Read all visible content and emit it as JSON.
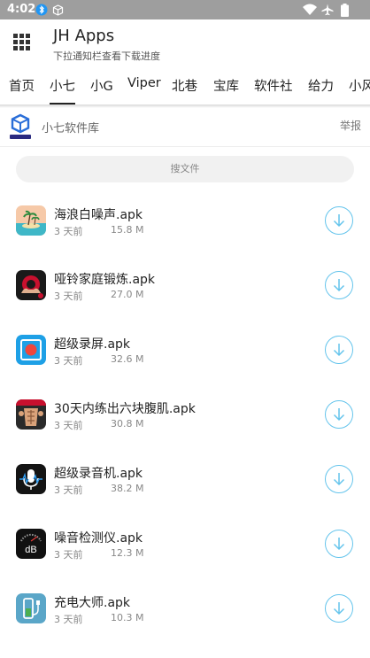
{
  "status_bar": {
    "time": "4:02",
    "left_icons": [
      "bluetooth-icon",
      "cube-icon"
    ],
    "right_icons": [
      "wifi-icon",
      "airplane-icon",
      "battery-icon"
    ]
  },
  "app_bar": {
    "title": "JH Apps",
    "subtitle": "下拉通知栏查看下载进度",
    "menu_icon": "grid-icon"
  },
  "tabs": [
    {
      "label": "首页",
      "active": false
    },
    {
      "label": "小七",
      "active": true
    },
    {
      "label": "小G",
      "active": false
    },
    {
      "label": "Viper",
      "active": false
    },
    {
      "label": "北巷",
      "active": false
    },
    {
      "label": "宝库",
      "active": false
    },
    {
      "label": "软件社",
      "active": false
    },
    {
      "label": "给力",
      "active": false
    },
    {
      "label": "小风",
      "active": false
    }
  ],
  "source": {
    "name": "小七软件库",
    "report_label": "举报"
  },
  "search": {
    "placeholder": "搜文件"
  },
  "files": [
    {
      "name": "海浪白噪声.apk",
      "ago": "3 天前",
      "size": "15.8 M",
      "icon": "beach-icon"
    },
    {
      "name": "哑铃家庭锻炼.apk",
      "ago": "3 天前",
      "size": "27.0 M",
      "icon": "fitness-icon"
    },
    {
      "name": "超级录屏.apk",
      "ago": "3 天前",
      "size": "32.6 M",
      "icon": "record-icon"
    },
    {
      "name": "30天内练出六块腹肌.apk",
      "ago": "3 天前",
      "size": "30.8 M",
      "icon": "abs-icon"
    },
    {
      "name": "超级录音机.apk",
      "ago": "3 天前",
      "size": "38.2 M",
      "icon": "microphone-icon"
    },
    {
      "name": "噪音检测仪.apk",
      "ago": "3 天前",
      "size": "12.3 M",
      "icon": "db-meter-icon"
    },
    {
      "name": "充电大师.apk",
      "ago": "3 天前",
      "size": "10.3 M",
      "icon": "charging-icon"
    }
  ],
  "colors": {
    "accent": "#64c4ec",
    "status_bar": "#9e9e9e"
  }
}
